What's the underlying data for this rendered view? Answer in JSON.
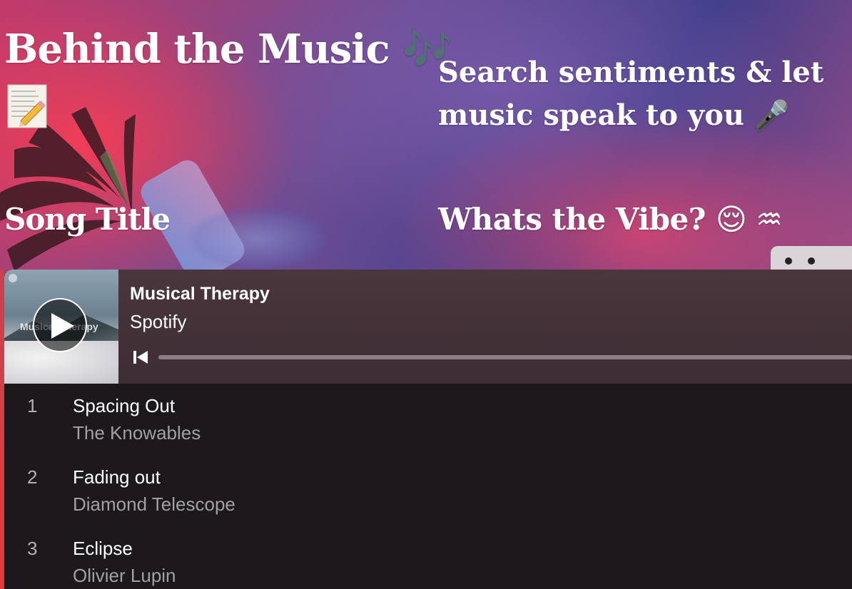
{
  "header": {
    "title": "Behind the Music",
    "title_emoji": "🎶",
    "memo_emoji": "📝",
    "search_prompt": "Search sentiments & let music speak to you",
    "search_emoji": "🎤",
    "song_title_label": "Song Title",
    "vibe_label": "Whats the Vibe?",
    "vibe_emojis": "😌 ♒"
  },
  "player": {
    "cover_label": "Musical Therapy",
    "playlist_title": "Musical Therapy",
    "source": "Spotify",
    "progress": 0.0,
    "tracks": [
      {
        "number": "1",
        "name": "Spacing Out",
        "artist": "The Knowables"
      },
      {
        "number": "2",
        "name": "Fading out",
        "artist": "Diamond Telescope"
      },
      {
        "number": "3",
        "name": "Eclipse",
        "artist": "Olivier Lupin"
      }
    ]
  },
  "colors": {
    "player_bg": "#1d181c",
    "player_header": "#4a363d",
    "text_muted": "#a3a0a2"
  },
  "icons": {
    "play": "play-icon",
    "previous": "skip-previous-icon",
    "memo": "memo-icon",
    "microphone": "microphone-icon",
    "notes": "music-notes-icon"
  }
}
